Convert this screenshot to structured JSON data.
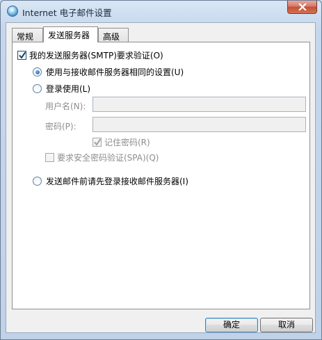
{
  "window": {
    "title": "Internet 电子邮件设置",
    "icon": "globe-icon"
  },
  "tabs": [
    {
      "label": "常规",
      "active": false
    },
    {
      "label": "发送服务器",
      "active": true
    },
    {
      "label": "高级",
      "active": false
    }
  ],
  "outgoing": {
    "require_auth_label": "我的发送服务器(SMTP)要求验证(O)",
    "require_auth_checked": true,
    "use_same_label": "使用与接收邮件服务器相同的设置(U)",
    "use_same_selected": true,
    "logon_using_label": "登录使用(L)",
    "logon_using_selected": false,
    "username_label": "用户名(N):",
    "username_value": "",
    "password_label": "密码(P):",
    "password_value": "",
    "remember_password_label": "记住密码(R)",
    "remember_password_checked": true,
    "spa_label": "要求安全密码验证(SPA)(Q)",
    "spa_checked": false,
    "logon_before_send_label": "发送邮件前请先登录接收邮件服务器(I)",
    "logon_before_send_selected": false
  },
  "buttons": {
    "ok_label": "确定",
    "cancel_label": "取消"
  },
  "colors": {
    "title_bar": "#c5d7ec",
    "close_button": "#c45039",
    "accent": "#1c5180"
  }
}
